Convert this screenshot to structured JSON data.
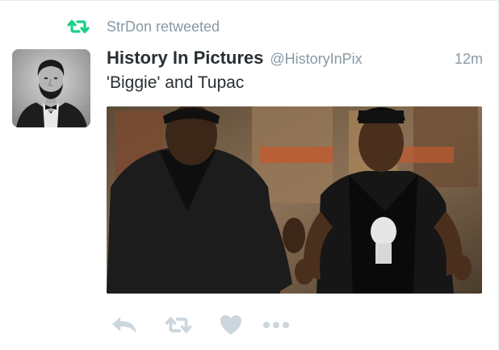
{
  "context": {
    "icon": "retweet-icon",
    "text": "StrDon retweeted",
    "icon_color": "#19cf86"
  },
  "author": {
    "full_name": "History In Pictures",
    "username": "@HistoryInPix",
    "avatar": "portrait-avatar"
  },
  "tweet": {
    "timestamp": "12m",
    "text": "'Biggie' and Tupac",
    "media": "photo"
  },
  "actions": [
    {
      "name": "reply",
      "icon": "reply-icon"
    },
    {
      "name": "retweet",
      "icon": "retweet-icon"
    },
    {
      "name": "like",
      "icon": "heart-icon"
    },
    {
      "name": "more",
      "icon": "more-dots-icon"
    }
  ],
  "colors": {
    "text_primary": "#292f33",
    "text_secondary": "#8899a6",
    "action_icon": "#ccd6dd",
    "retweet_green": "#19cf86"
  }
}
